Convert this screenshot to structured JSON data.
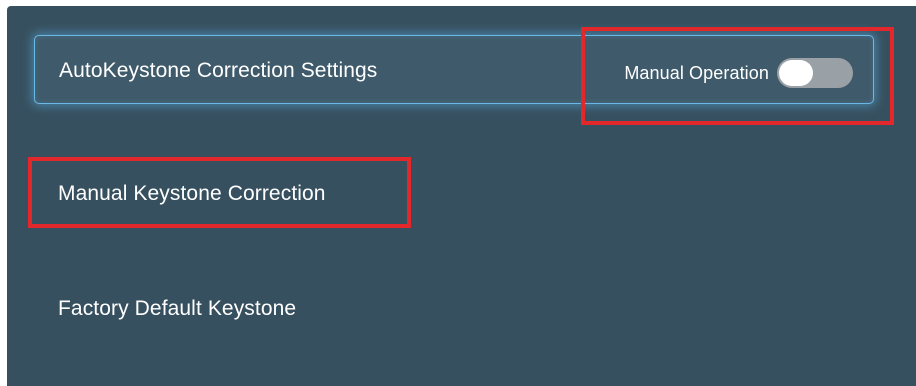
{
  "settings": {
    "auto_keystone": {
      "label": "AutoKeystone Correction Settings",
      "toggle_label": "Manual Operation",
      "toggle_state": "on"
    },
    "manual_keystone": {
      "label": "Manual Keystone Correction"
    },
    "factory_default": {
      "label": "Factory Default Keystone"
    }
  },
  "colors": {
    "panel_background": "#37505f",
    "focus_border": "#6bb7e6",
    "highlight_annotation": "#e3282b",
    "toggle_track": "#9aa1a6"
  }
}
